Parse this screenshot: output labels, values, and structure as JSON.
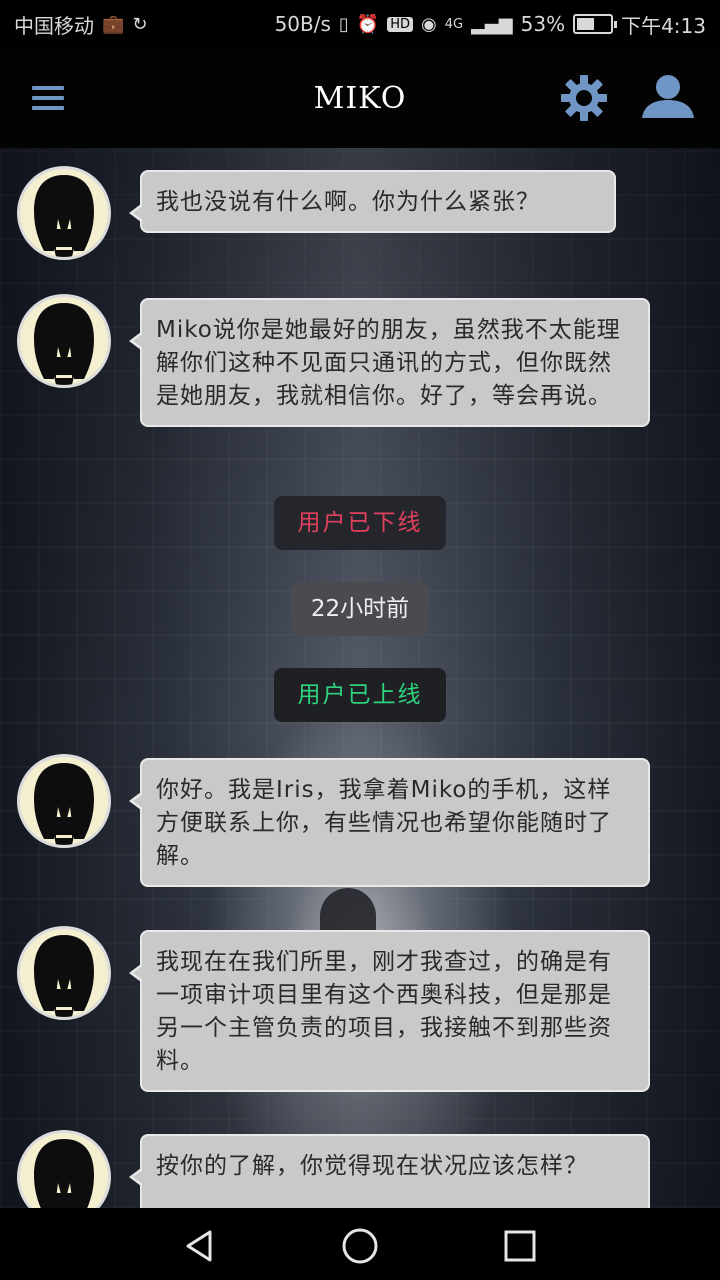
{
  "status_bar": {
    "carrier": "中国移动",
    "speed": "50B/s",
    "network": "4G",
    "battery": "53%",
    "battery_level": 0.53,
    "time": "下午4:13"
  },
  "app_bar": {
    "title": "MIKO"
  },
  "messages": [
    {
      "text": "我也没说有什么啊。你为什么紧张？"
    },
    {
      "text": "Miko说你是她最好的朋友，虽然我不太能理解你们这种不见面只通讯的方式，但你既然是她朋友，我就相信你。好了，等会再说。"
    },
    {
      "text": "你好。我是Iris，我拿着Miko的手机，这样方便联系上你，有些情况也希望你能随时了解。"
    },
    {
      "text": "我现在在我们所里，刚才我查过，的确是有一项审计项目里有这个西奥科技，但是那是另一个主管负责的项目，我接触不到那些资料。"
    },
    {
      "text": "按你的了解，你觉得现在状况应该怎样？"
    }
  ],
  "system": {
    "offline": "用户已下线",
    "time_ago": "22小时前",
    "online": "用户已上线"
  },
  "colors": {
    "accent": "#7096c6",
    "bubble": "#c9c9c9",
    "offline": "#e0405c",
    "online": "#2fd27e"
  },
  "icons": {
    "menu": "menu-icon",
    "settings": "gear-icon",
    "profile": "user-icon",
    "back": "back-triangle-icon",
    "home": "home-circle-icon",
    "recents": "recents-square-icon"
  }
}
